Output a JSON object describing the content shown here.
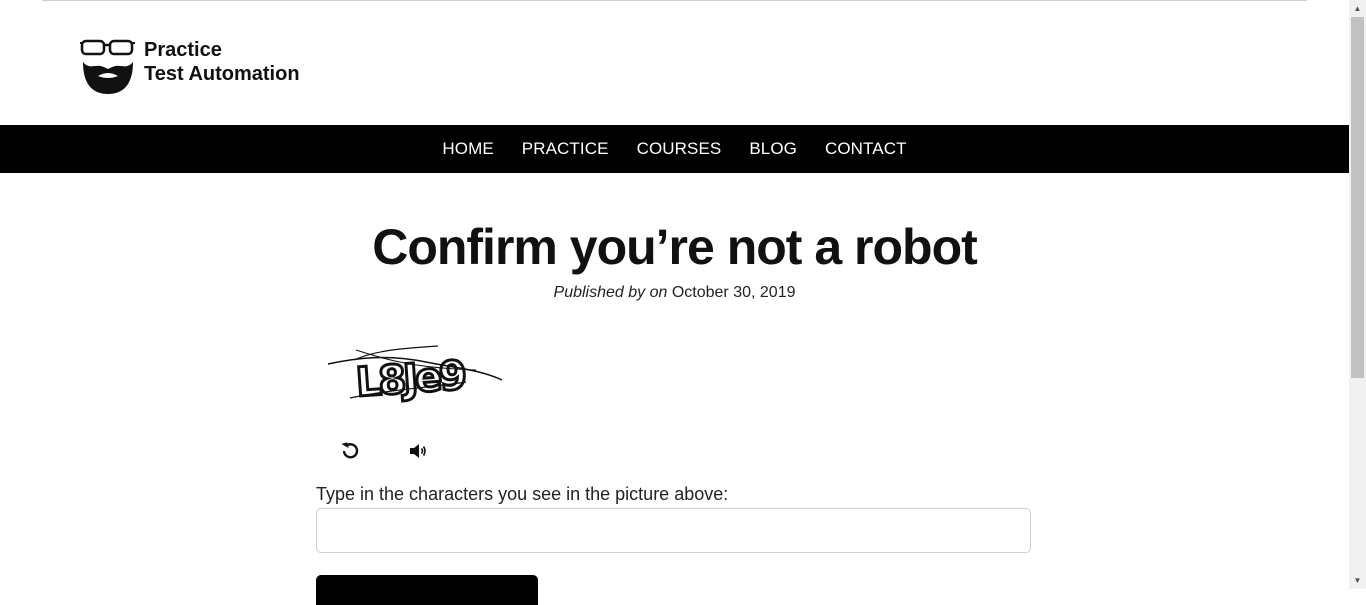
{
  "site": {
    "logo_line1": "Practice",
    "logo_line2": "Test Automation"
  },
  "nav": {
    "items": [
      {
        "label": "HOME"
      },
      {
        "label": "PRACTICE"
      },
      {
        "label": "COURSES"
      },
      {
        "label": "BLOG"
      },
      {
        "label": "CONTACT"
      }
    ]
  },
  "page": {
    "title": "Confirm you’re not a robot",
    "published_by": "Published by",
    "on": "on",
    "date": "October 30, 2019"
  },
  "captcha": {
    "image_text": "L8Je9",
    "refresh_icon": "refresh-icon",
    "audio_icon": "speaker-icon",
    "label": "Type in the characters you see in the picture above:",
    "input_value": "",
    "input_placeholder": ""
  },
  "colors": {
    "nav_bg": "#000000",
    "nav_text": "#ffffff",
    "title": "#111111"
  }
}
